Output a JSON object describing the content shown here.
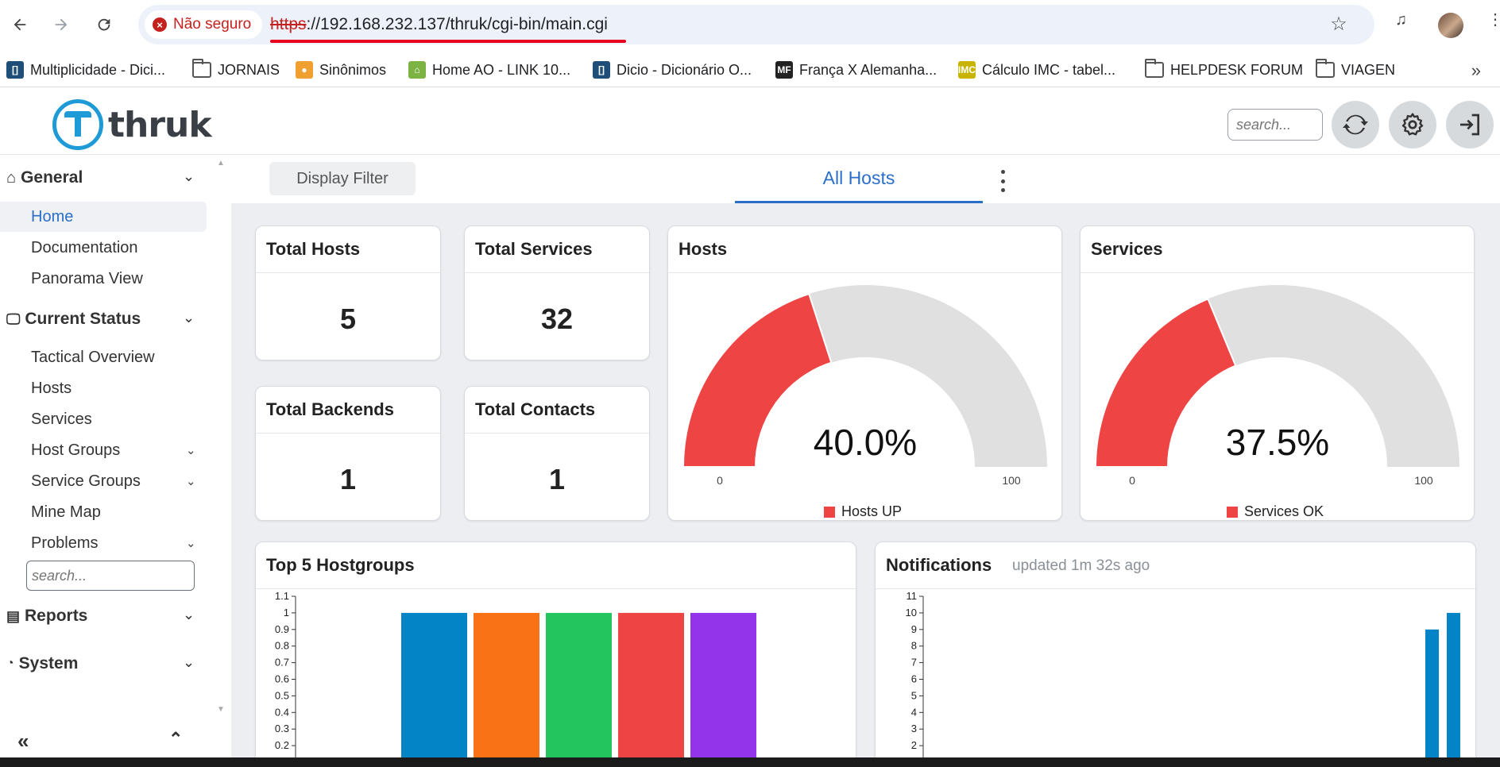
{
  "browser": {
    "security_label": "Não seguro",
    "url_scheme": "https",
    "url_rest": "://192.168.232.137/thruk/cgi-bin/main.cgi",
    "bookmarks": [
      {
        "label": "Multiplicidade - Dici...",
        "type": "site",
        "color": "#1f4e79",
        "glyph": "[]"
      },
      {
        "label": "JORNAIS",
        "type": "folder"
      },
      {
        "label": "Sinônimos",
        "type": "site",
        "color": "#f0a030",
        "glyph": "●"
      },
      {
        "label": "Home AO - LINK 10...",
        "type": "site",
        "color": "#7cb342",
        "glyph": "⌂"
      },
      {
        "label": "Dicio - Dicionário O...",
        "type": "site",
        "color": "#1f4e79",
        "glyph": "[]"
      },
      {
        "label": "França X Alemanha...",
        "type": "site",
        "color": "#222222",
        "glyph": "MF"
      },
      {
        "label": "Cálculo IMC - tabel...",
        "type": "site",
        "color": "#c8b400",
        "glyph": "IMC"
      },
      {
        "label": "HELPDESK FORUM",
        "type": "folder"
      },
      {
        "label": "VIAGEN",
        "type": "folder"
      }
    ]
  },
  "header": {
    "logo_text": "thruk",
    "search_placeholder": "search..."
  },
  "sidebar": {
    "general": {
      "label": "General",
      "items": [
        "Home",
        "Documentation",
        "Panorama View"
      ]
    },
    "current_status": {
      "label": "Current Status",
      "items": [
        "Tactical Overview",
        "Hosts",
        "Services",
        "Host Groups",
        "Service Groups",
        "Mine Map",
        "Problems"
      ]
    },
    "search_placeholder": "search...",
    "reports": {
      "label": "Reports"
    },
    "system": {
      "label": "System"
    }
  },
  "tabs": {
    "display_filter": "Display Filter",
    "all_hosts": "All Hosts"
  },
  "stats": {
    "total_hosts": {
      "label": "Total Hosts",
      "value": "5"
    },
    "total_services": {
      "label": "Total Services",
      "value": "32"
    },
    "total_backends": {
      "label": "Total Backends",
      "value": "1"
    },
    "total_contacts": {
      "label": "Total Contacts",
      "value": "1"
    }
  },
  "gauges": {
    "hosts": {
      "title": "Hosts",
      "percent": 40.0,
      "percent_label": "40.0%",
      "min_label": "0",
      "max_label": "100",
      "legend": "Hosts UP"
    },
    "services": {
      "title": "Services",
      "percent": 37.5,
      "percent_label": "37.5%",
      "min_label": "0",
      "max_label": "100",
      "legend": "Services OK"
    }
  },
  "hostgroups": {
    "title": "Top 5 Hostgroups"
  },
  "notifications": {
    "title": "Notifications",
    "updated": "updated 1m 32s ago"
  },
  "colors": {
    "accent": "#2b6fc9",
    "gauge_fill": "#ef4444",
    "gauge_bg": "#e0e0e0",
    "bar_blue": "#0284c7"
  },
  "chart_data": [
    {
      "type": "gauge",
      "title": "Hosts",
      "value": 40.0,
      "range": [
        0,
        100
      ],
      "legend": "Hosts UP"
    },
    {
      "type": "gauge",
      "title": "Services",
      "value": 37.5,
      "range": [
        0,
        100
      ],
      "legend": "Services OK"
    },
    {
      "type": "bar",
      "title": "Top 5 Hostgroups",
      "values": [
        1,
        1,
        1,
        1,
        1
      ],
      "colors": [
        "#0284c7",
        "#f97316",
        "#22c55e",
        "#ef4444",
        "#9333ea"
      ],
      "ylim": [
        0,
        1.1
      ],
      "yticks": [
        "0.2",
        "0.3",
        "0.4",
        "0.5",
        "0.6",
        "0.7",
        "0.8",
        "0.9",
        "1",
        "1.1"
      ],
      "grid": false
    },
    {
      "type": "bar",
      "title": "Notifications",
      "values": [
        9,
        10
      ],
      "color": "#0284c7",
      "ylim": [
        0,
        11
      ],
      "yticks": [
        "2",
        "3",
        "4",
        "5",
        "6",
        "7",
        "8",
        "9",
        "10",
        "11"
      ],
      "grid": false
    }
  ]
}
